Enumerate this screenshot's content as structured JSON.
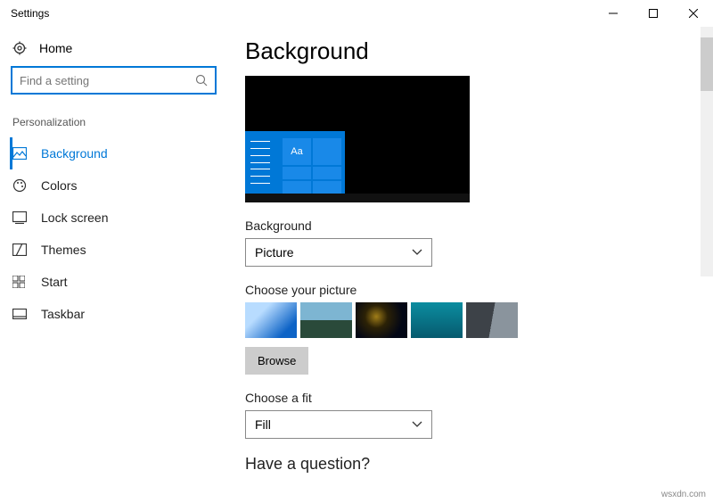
{
  "window": {
    "title": "Settings"
  },
  "sidebar": {
    "home": "Home",
    "search_placeholder": "Find a setting",
    "category": "Personalization",
    "items": [
      {
        "label": "Background"
      },
      {
        "label": "Colors"
      },
      {
        "label": "Lock screen"
      },
      {
        "label": "Themes"
      },
      {
        "label": "Start"
      },
      {
        "label": "Taskbar"
      }
    ]
  },
  "main": {
    "title": "Background",
    "preview_tile_text": "Aa",
    "background_label": "Background",
    "background_value": "Picture",
    "choose_picture_label": "Choose your picture",
    "browse_label": "Browse",
    "fit_label": "Choose a fit",
    "fit_value": "Fill",
    "question_title": "Have a question?"
  },
  "watermark": "wsxdn.com"
}
